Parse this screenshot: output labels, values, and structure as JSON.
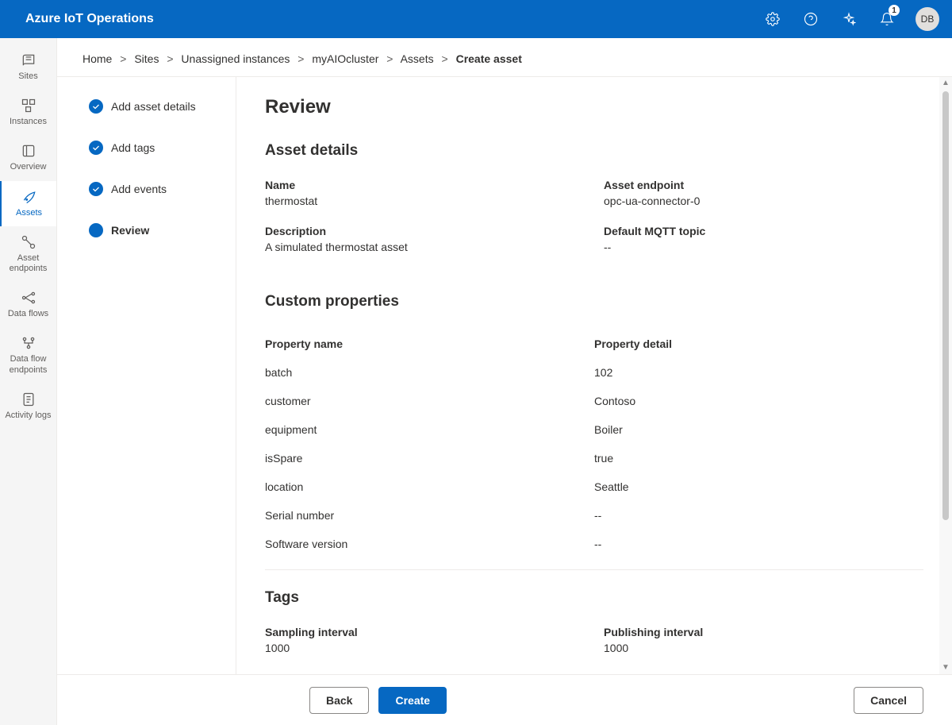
{
  "header": {
    "title": "Azure IoT Operations",
    "notification_count": "1",
    "user_initials": "DB"
  },
  "left_rail": {
    "items": [
      {
        "label": "Sites"
      },
      {
        "label": "Instances"
      },
      {
        "label": "Overview"
      },
      {
        "label": "Assets"
      },
      {
        "label": "Asset endpoints"
      },
      {
        "label": "Data flows"
      },
      {
        "label": "Data flow endpoints"
      },
      {
        "label": "Activity logs"
      }
    ]
  },
  "breadcrumb": {
    "items": [
      "Home",
      "Sites",
      "Unassigned instances",
      "myAIOcluster",
      "Assets"
    ],
    "current": "Create asset"
  },
  "steps": {
    "items": [
      {
        "label": "Add asset details"
      },
      {
        "label": "Add tags"
      },
      {
        "label": "Add events"
      },
      {
        "label": "Review"
      }
    ]
  },
  "review": {
    "heading": "Review",
    "asset_details": {
      "title": "Asset details",
      "name_label": "Name",
      "name_value": "thermostat",
      "endpoint_label": "Asset endpoint",
      "endpoint_value": "opc-ua-connector-0",
      "description_label": "Description",
      "description_value": "A simulated thermostat asset",
      "mqtt_label": "Default MQTT topic",
      "mqtt_value": "--"
    },
    "custom_properties": {
      "title": "Custom properties",
      "col_name": "Property name",
      "col_detail": "Property detail",
      "rows": [
        {
          "name": "batch",
          "detail": "102"
        },
        {
          "name": "customer",
          "detail": "Contoso"
        },
        {
          "name": "equipment",
          "detail": "Boiler"
        },
        {
          "name": "isSpare",
          "detail": "true"
        },
        {
          "name": "location",
          "detail": "Seattle"
        },
        {
          "name": "Serial number",
          "detail": "--"
        },
        {
          "name": "Software version",
          "detail": "--"
        }
      ]
    },
    "tags": {
      "title": "Tags",
      "sampling_label": "Sampling interval",
      "sampling_value": "1000",
      "publishing_label": "Publishing interval",
      "publishing_value": "1000"
    }
  },
  "footer": {
    "back": "Back",
    "create": "Create",
    "cancel": "Cancel"
  }
}
